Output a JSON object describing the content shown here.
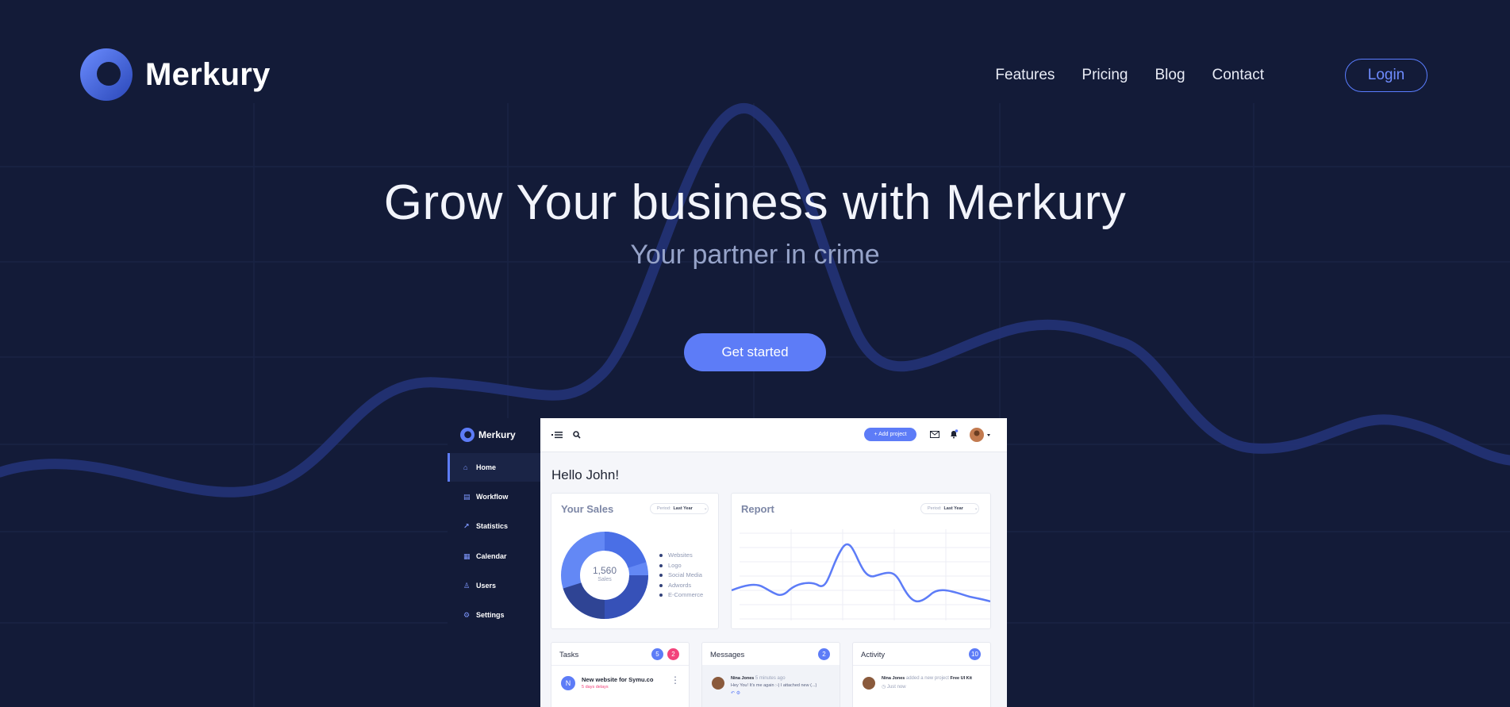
{
  "brand": {
    "name": "Merkury"
  },
  "nav": {
    "items": [
      {
        "label": "Features"
      },
      {
        "label": "Pricing"
      },
      {
        "label": "Blog"
      },
      {
        "label": "Contact"
      }
    ],
    "login_label": "Login"
  },
  "hero": {
    "title": "Grow Your business with Merkury",
    "subtitle": "Your partner in crime",
    "cta_label": "Get started"
  },
  "dashboard": {
    "brand": "Merkury",
    "sidebar": [
      {
        "label": "Home",
        "icon": "home-icon",
        "glyph": "⌂"
      },
      {
        "label": "Workflow",
        "icon": "workflow-icon",
        "glyph": "▤"
      },
      {
        "label": "Statistics",
        "icon": "statistics-icon",
        "glyph": "↗"
      },
      {
        "label": "Calendar",
        "icon": "calendar-icon",
        "glyph": "▦"
      },
      {
        "label": "Users",
        "icon": "user-icon",
        "glyph": "♙"
      },
      {
        "label": "Settings",
        "icon": "gear-icon",
        "glyph": "⚙"
      }
    ],
    "add_project_label": "+ Add project",
    "greeting": "Hello John!",
    "sales": {
      "title": "Your Sales",
      "period_label": "Period:",
      "period_value": "Last Year",
      "total": "1,560",
      "total_label": "Sales",
      "legend": [
        "Websites",
        "Logo",
        "Social Media",
        "Adwords",
        "E-Commerce"
      ]
    },
    "report": {
      "title": "Report",
      "period_label": "Period:",
      "period_value": "Last Year"
    },
    "tasks": {
      "title": "Tasks",
      "badge_a": "5",
      "badge_b": "2",
      "item_initial": "N",
      "item_title": "New website for Symu.co",
      "item_time": "5 days delays"
    },
    "messages": {
      "title": "Messages",
      "badge": "2",
      "item_name": "Nina Jones",
      "item_time": "5 minutes ago",
      "item_text": "Hey You! It's me again :-) I attached new (...)"
    },
    "activity": {
      "title": "Activity",
      "badge": "10",
      "item_name": "Nina Jones",
      "item_action": "added a new project",
      "item_project": "Free UI Kit",
      "item_time": "Just now"
    }
  },
  "colors": {
    "background": "#131b38",
    "accent": "#5d7cf7",
    "badge_pink": "#f2437b"
  }
}
